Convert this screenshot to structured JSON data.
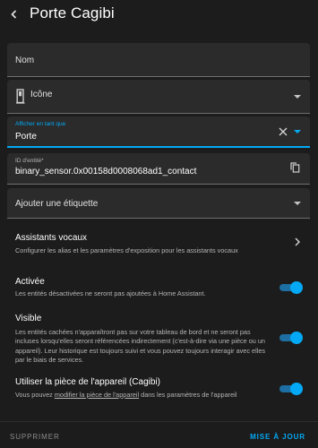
{
  "header": {
    "title": "Porte Cagibi",
    "back_icon": "chevron-left-icon"
  },
  "fields": {
    "name": {
      "label": "Nom"
    },
    "icon": {
      "label": "Icône",
      "icon": "door-icon"
    },
    "show_as": {
      "label": "Afficher en tant que",
      "value": "Porte",
      "clear_icon": "close-icon"
    },
    "entity_id": {
      "label": "ID d'entité*",
      "value": "binary_sensor.0x00158d0008068ad1_contact",
      "copy_icon": "copy-icon"
    },
    "labels": {
      "label": "Ajouter une étiquette"
    }
  },
  "voice": {
    "title": "Assistants vocaux",
    "desc": "Configurer les alias et les paramètres d'exposition pour les assistants vocaux"
  },
  "enabled": {
    "title": "Activée",
    "desc": "Les entités désactivées ne seront pas ajoutées à Home Assistant.",
    "checked": true
  },
  "visible": {
    "title": "Visible",
    "desc": "Les entités cachées n'apparaîtront pas sur votre tableau de bord et ne seront pas incluses lorsqu'elles seront référencées indirectement (c'est-à-dire via une pièce ou un appareil). Leur historique est toujours suivi et vous pouvez toujours interagir avec elles par le biais de services.",
    "checked": true
  },
  "area": {
    "title": "Utiliser la pièce de l'appareil (Cagibi)",
    "desc_before": "Vous pouvez ",
    "desc_link": "modifier la pièce de l'appareil",
    "desc_after": " dans les paramètres de l'appareil",
    "checked": true
  },
  "footer": {
    "delete": "SUPPRIMER",
    "update": "MISE À JOUR"
  },
  "colors": {
    "accent": "#03a9f4",
    "danger_muted": "#8d8d8d",
    "surface": "#1c1c1c",
    "field": "#2b2b2b"
  }
}
